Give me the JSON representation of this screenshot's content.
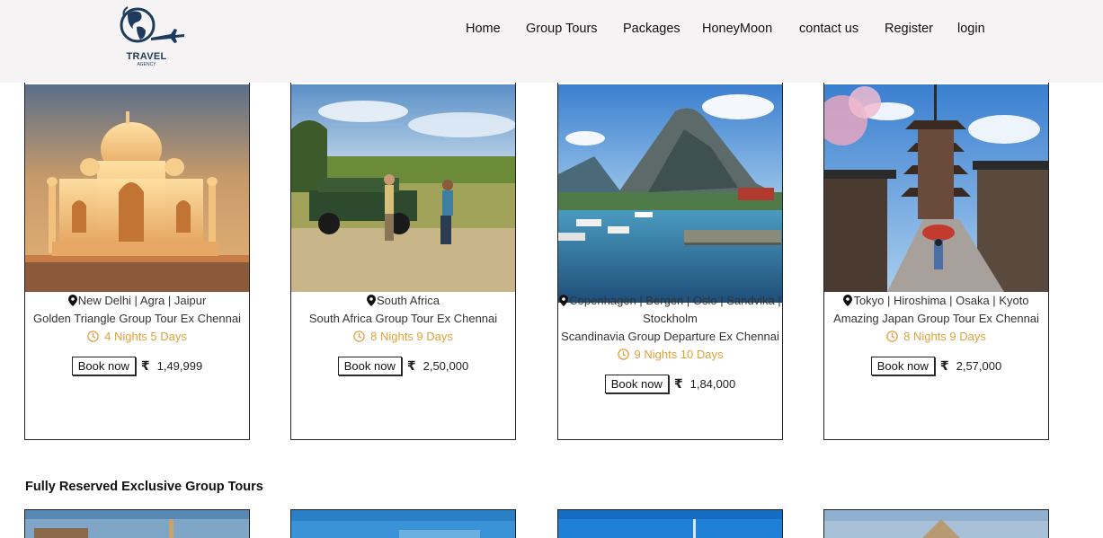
{
  "header": {
    "logo_text": "TRAVEL",
    "logo_sub": "AGENCY",
    "nav": [
      "Home",
      "Group Tours",
      "Packages",
      "HoneyMoon",
      "contact us",
      "Register",
      "login"
    ]
  },
  "tours": [
    {
      "location": "New Delhi | Agra | Jaipur",
      "title": "Golden Triangle Group Tour Ex Chennai",
      "duration": "4 Nights 5 Days",
      "button": "Book now",
      "currency": "₹",
      "price": "1,49,999"
    },
    {
      "location": "South Africa",
      "title": "South Africa Group Tour Ex Chennai",
      "duration": "8 Nights 9 Days",
      "button": "Book now",
      "currency": "₹",
      "price": "2,50,000"
    },
    {
      "location": "Copenhagen | Bergen | Oslo | Sandvika | Stockholm",
      "title": "Scandinavia Group Departure Ex Chennai",
      "duration": "9 Nights 10 Days",
      "button": "Book now",
      "currency": "₹",
      "price": "1,84,000"
    },
    {
      "location": "Tokyo | Hiroshima | Osaka | Kyoto",
      "title": "Amazing Japan Group Tour Ex Chennai",
      "duration": "8 Nights 9 Days",
      "button": "Book now",
      "currency": "₹",
      "price": "2,57,000"
    }
  ],
  "section": {
    "title": "Fully Reserved Exclusive Group Tours"
  },
  "colors": {
    "accent": "#e0a13a",
    "header_bg": "#f5f3f3",
    "logo": "#1e3a5c"
  },
  "icons": [
    "globe-plane-logo-icon",
    "map-pin-icon",
    "clock-icon",
    "rupee-icon"
  ]
}
